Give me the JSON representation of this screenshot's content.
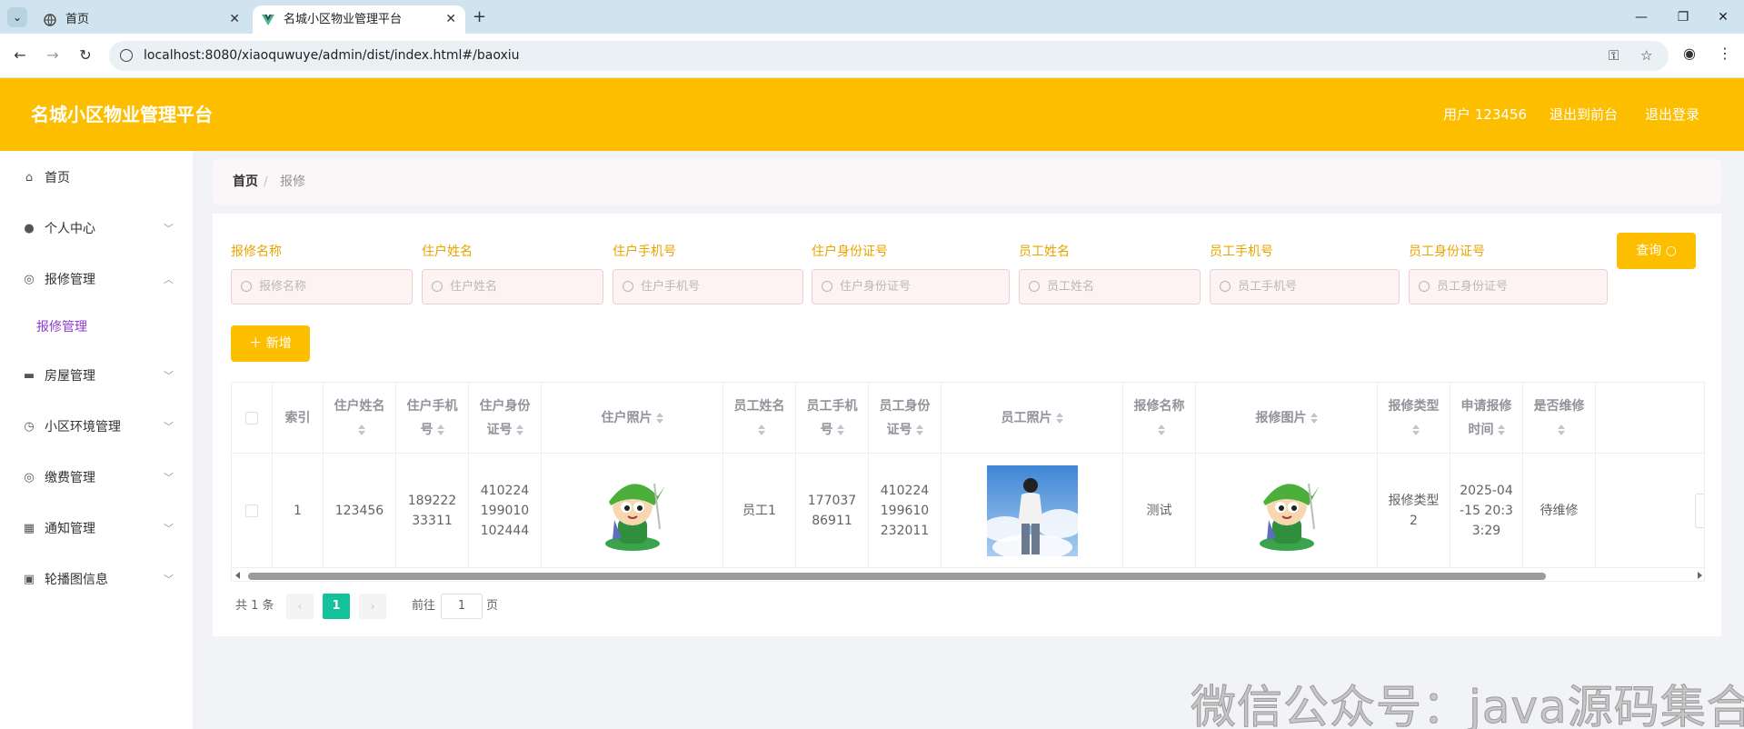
{
  "browser": {
    "tabs": [
      {
        "title": "首页",
        "active": false
      },
      {
        "title": "名城小区物业管理平台",
        "active": true
      }
    ],
    "url": "localhost:8080/xiaoquwuye/admin/dist/index.html#/baoxiu",
    "window_controls": {
      "minimize": "—",
      "restore": "❐",
      "close": "✕"
    }
  },
  "header": {
    "title": "名城小区物业管理平台",
    "user": "用户 123456",
    "to_front": "退出到前台",
    "logout": "退出登录",
    "color": "#fdbe00"
  },
  "sidebar": {
    "items": [
      {
        "label": "首页",
        "icon": "home-icon"
      },
      {
        "label": "个人中心",
        "icon": "user-icon"
      },
      {
        "label": "报修管理",
        "icon": "tool-icon",
        "expanded": true,
        "children": [
          {
            "label": "报修管理"
          }
        ]
      },
      {
        "label": "房屋管理",
        "icon": "briefcase-icon"
      },
      {
        "label": "小区环境管理",
        "icon": "clock-icon"
      },
      {
        "label": "缴费管理",
        "icon": "coin-icon"
      },
      {
        "label": "通知管理",
        "icon": "grid-icon"
      },
      {
        "label": "轮播图信息",
        "icon": "camera-icon"
      }
    ]
  },
  "breadcrumb": {
    "home": "首页",
    "sep": "/",
    "current": "报修"
  },
  "search": {
    "fields": [
      {
        "label": "报修名称",
        "placeholder": "报修名称"
      },
      {
        "label": "住户姓名",
        "placeholder": "住户姓名"
      },
      {
        "label": "住户手机号",
        "placeholder": "住户手机号"
      },
      {
        "label": "住户身份证号",
        "placeholder": "住户身份证号"
      },
      {
        "label": "员工姓名",
        "placeholder": "员工姓名"
      },
      {
        "label": "员工手机号",
        "placeholder": "员工手机号"
      },
      {
        "label": "员工身份证号",
        "placeholder": "员工身份证号"
      }
    ],
    "query_label": "查询 ○",
    "add_label": "＋ 新增"
  },
  "table": {
    "columns": [
      "",
      "索引",
      "住户姓名",
      "住户手机号",
      "住户身份证号",
      "住户照片",
      "员工姓名",
      "员工手机号",
      "员工身份证号",
      "员工照片",
      "报修名称",
      "报修图片",
      "报修类型",
      "申请报修时间",
      "是否维修",
      ""
    ],
    "rows": [
      {
        "index": "1",
        "resident_name": "123456",
        "resident_phone": "18922233311",
        "resident_id": "410224199010102444",
        "staff_name": "员工1",
        "staff_phone": "17703786911",
        "staff_id": "410224199610232011",
        "repair_name": "测试",
        "repair_type": "报修类型2",
        "apply_time": "2025-04-15 20:33:29",
        "status": "待维修"
      }
    ]
  },
  "pagination": {
    "total": "共 1 条",
    "prev": "‹",
    "page": "1",
    "next": "›",
    "goto": "前往",
    "goto_value": "1",
    "page_unit": "页"
  },
  "watermark": "微信公众号：java源码集合"
}
